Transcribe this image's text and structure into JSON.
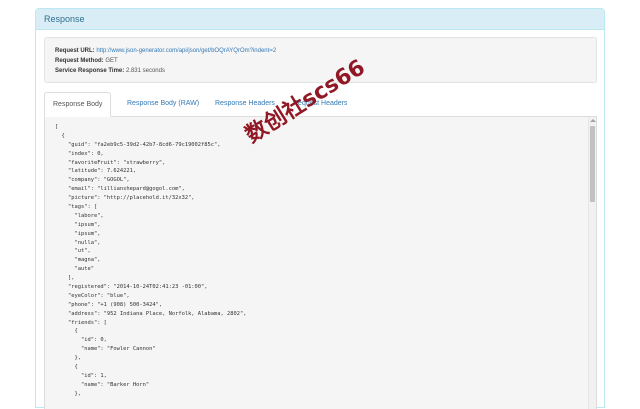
{
  "panel": {
    "title": "Response"
  },
  "request_info": {
    "url_label": "Request URL:",
    "url_value": "http://www.json-generator.com/api/json/get/bOQrAYQrOm?indent=2",
    "method_label": "Request Method:",
    "method_value": "GET",
    "time_label": "Service Response Time:",
    "time_value": "2.831 seconds"
  },
  "tabs": [
    {
      "label": "Response Body",
      "active": true
    },
    {
      "label": "Response Body (RAW)",
      "active": false
    },
    {
      "label": "Response Headers",
      "active": false
    },
    {
      "label": "Request Headers",
      "active": false
    }
  ],
  "response_body_lines": [
    "[",
    "  {",
    "    \"guid\": \"fa2eb9c5-39d2-42b7-8cd6-79c19002f85c\",",
    "    \"index\": 0,",
    "    \"favoriteFruit\": \"strawberry\",",
    "    \"latitude\": 7.624221,",
    "    \"company\": \"GOGOL\",",
    "    \"email\": \"lillianshepard@gogol.com\",",
    "    \"picture\": \"http://placehold.it/32x32\",",
    "    \"tags\": [",
    "      \"labore\",",
    "      \"ipsum\",",
    "      \"ipsum\",",
    "      \"nulla\",",
    "      \"ut\",",
    "      \"magna\",",
    "      \"aute\"",
    "    ],",
    "    \"registered\": \"2014-10-24T02:41:23 -01:00\",",
    "    \"eyeColor\": \"blue\",",
    "    \"phone\": \"+1 (908) 500-3424\",",
    "    \"address\": \"952 Indiana Place, Norfolk, Alabama, 2802\",",
    "    \"friends\": [",
    "      {",
    "        \"id\": 0,",
    "        \"name\": \"Fowler Cannon\"",
    "      },",
    "      {",
    "        \"id\": 1,",
    "        \"name\": \"Barker Horn\"",
    "      },"
  ],
  "watermark": {
    "text": "数创社scs66"
  },
  "colors": {
    "panel_heading_bg": "#d9edf7",
    "panel_border": "#bce8f1",
    "panel_title": "#31708f",
    "link": "#337ab7",
    "code_bg": "#f5f5f5",
    "watermark": "#8b0d1a"
  },
  "icons": {
    "scroll_up": "scroll-up-arrow-icon"
  }
}
